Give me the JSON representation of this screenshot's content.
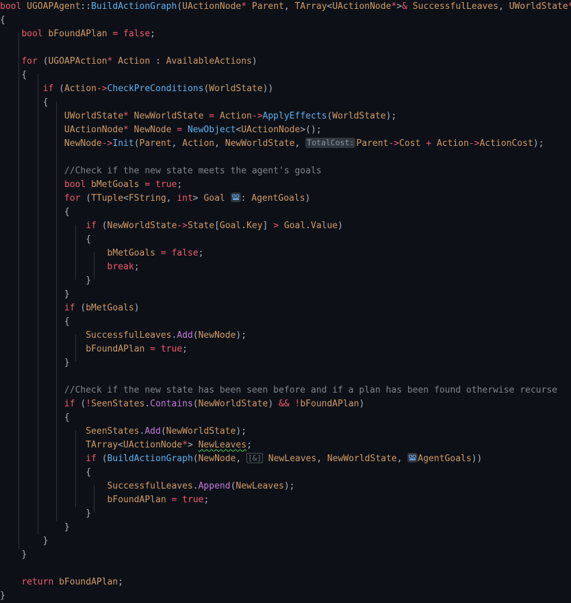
{
  "editor": {
    "language": "cpp",
    "background_color": "#0d1117",
    "font_size_px": 13,
    "line_height_px": 20,
    "theme_colors": {
      "keyword": "#ef596f",
      "type": "#d19a66",
      "function": "#61afef",
      "method": "#c678dd",
      "comment": "#7f848e",
      "punctuation": "#abb2bf",
      "inlay_hint_bg": "#2f353d",
      "inlay_hint_fg": "#8b949e",
      "indent_guide": "#2c333d",
      "warning_squiggle": "#55c463"
    }
  },
  "code": {
    "signature_line": "bool UGOAPAgent::BuildActionGraph(UActionNode* Parent, TArray<UActionNode*>& SuccessfulLeaves, UWorldState* WorldState,",
    "lines": [
      "bool UGOAPAgent::BuildActionGraph(UActionNode* Parent, TArray<UActionNode*>& SuccessfulLeaves, UWorldState* WorldState,",
      "{",
      "",
      "    bool bFoundAPlan = false;",
      "",
      "    for (UGOAPAction* Action : AvailableActions)",
      "    {",
      "        if (Action->CheckPreConditions(WorldState))",
      "        {",
      "            UWorldState* NewWorldState = Action->ApplyEffects(WorldState);",
      "            UActionNode* NewNode = NewObject<UActionNode>();",
      "            NewNode->Init(Parent, Action, NewWorldState, TotalCost: Parent->Cost + Action->ActionCost);",
      "",
      "            //Check if the new state meets the agent's goals",
      "            bool bMetGoals = true;",
      "            for (TTuple<FString, int> Goal : AgentGoals)",
      "            {",
      "                if (NewWorldState->State[Goal.Key] > Goal.Value)",
      "                {",
      "                    bMetGoals = false;",
      "                    break;",
      "                }",
      "            }",
      "            if (bMetGoals)",
      "            {",
      "                SuccessfulLeaves.Add(NewNode);",
      "                bFoundAPlan = true;",
      "            }",
      "",
      "            //Check if the new state has been seen before and if a plan has been found otherwise recurse",
      "            if (!SeenStates.Contains(NewWorldState) && !bFoundAPlan)",
      "            {",
      "                SeenStates.Add(NewWorldState);",
      "                TArray<UActionNode*> NewLeaves;",
      "                if (BuildActionGraph(NewNode, [&] NewLeaves, NewWorldState, AgentGoals))",
      "                {",
      "                    SuccessfulLeaves.Append(NewLeaves);",
      "                    bFoundAPlan = true;",
      "                }",
      "            }",
      "        }",
      "    }",
      "",
      "    return bFoundAPlan;",
      "}"
    ],
    "inlay_hints": [
      {
        "text": "TotalCost:",
        "line": 11,
        "style": "pill"
      },
      {
        "text": "[&]",
        "line": 33,
        "style": "box"
      }
    ],
    "icon_badges": [
      {
        "name": "reference-parameter-icon",
        "line": 15,
        "after": "Goal"
      },
      {
        "name": "reference-parameter-icon",
        "line": 33,
        "before": "AgentGoals"
      }
    ],
    "warnings": [
      {
        "text": "NewLeaves",
        "line": 32,
        "kind": "squiggle-green"
      }
    ],
    "comments": [
      "//Check if the new state meets the agent's goals",
      "//Check if the new state has been seen before and if a plan has been found otherwise recurse"
    ]
  }
}
